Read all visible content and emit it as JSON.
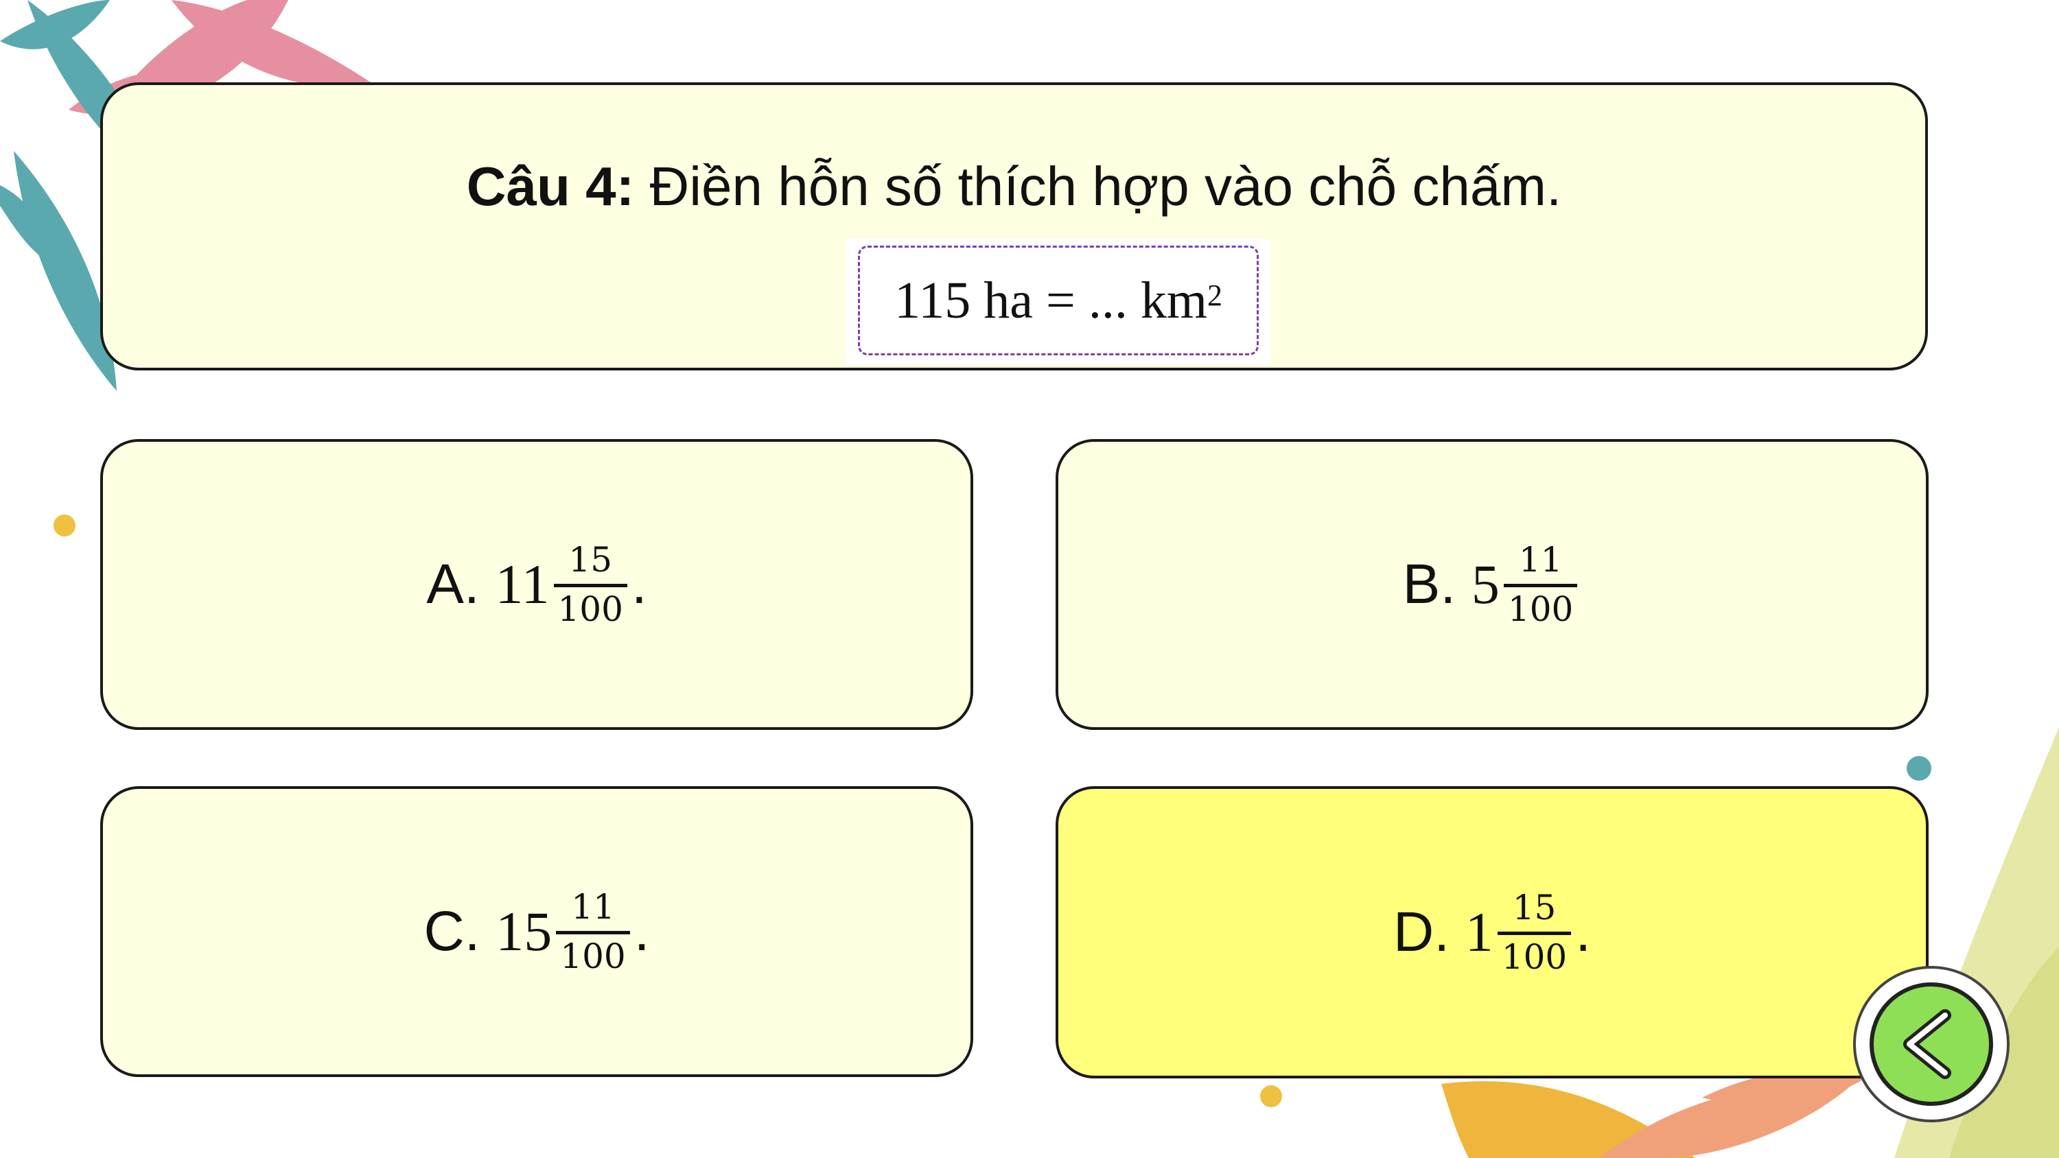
{
  "colors": {
    "card_background": "#ffffe1",
    "selected_card_background": "#ffff7c",
    "card_border": "#1a1a1a",
    "expression_border": "#7a3fb5",
    "back_button_fill": "#8fdf56"
  },
  "question": {
    "label": "Câu 4:",
    "text": " Điền hỗn số thích hợp vào chỗ chấm.",
    "expression_main": "115 ha = ... km",
    "expression_sup": "2"
  },
  "answers": [
    {
      "letter": "A.",
      "whole": "11",
      "numerator": "15",
      "denominator": "100",
      "suffix": ".",
      "selected": false
    },
    {
      "letter": "B.",
      "whole": "5",
      "numerator": "11",
      "denominator": "100",
      "suffix": "",
      "selected": false
    },
    {
      "letter": "C.",
      "whole": "15",
      "numerator": "11",
      "denominator": "100",
      "suffix": ".",
      "selected": false
    },
    {
      "letter": "D.",
      "whole": "1",
      "numerator": "15",
      "denominator": "100",
      "suffix": ".",
      "selected": true
    }
  ],
  "navigation": {
    "back_icon": "chevron-left-icon"
  }
}
